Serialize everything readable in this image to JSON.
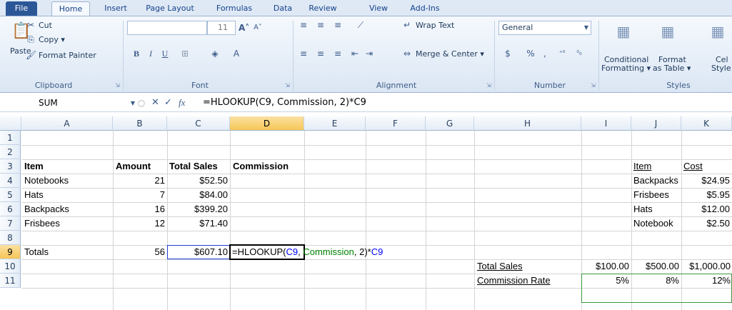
{
  "tabs": [
    "File",
    "Home",
    "Insert",
    "Page Layout",
    "Formulas",
    "Data",
    "Review",
    "View",
    "Add-Ins"
  ],
  "ribbon": {
    "clipboard": {
      "title": "Clipboard",
      "paste": "Paste",
      "cut": "Cut",
      "copy": "Copy ▾",
      "format_painter": "Format Painter"
    },
    "font": {
      "title": "Font",
      "size": "11",
      "bold": "B",
      "italic": "I",
      "underline": "U"
    },
    "alignment": {
      "title": "Alignment",
      "wrap_text": "Wrap Text",
      "merge_center": "Merge & Center ▾"
    },
    "number": {
      "title": "Number",
      "format": "General",
      "currency": "$",
      "percent": "%",
      "comma": ","
    },
    "styles": {
      "title": "Styles",
      "conditional": "Conditional",
      "conditional2": "Formatting ▾",
      "format_as": "Format",
      "format_as2": "as Table ▾",
      "cell_styles": "Cel",
      "cell_styles2": "Style"
    }
  },
  "formula_bar": {
    "name_box": "SUM",
    "formula": "=HLOOKUP(C9, Commission, 2)*C9",
    "cancel": "✕",
    "enter": "✓",
    "fx": "fx"
  },
  "columns": [
    "A",
    "B",
    "C",
    "D",
    "E",
    "F",
    "G",
    "H",
    "I",
    "J",
    "K"
  ],
  "rows": [
    "1",
    "2",
    "3",
    "4",
    "5",
    "6",
    "7",
    "8",
    "9",
    "10",
    "11"
  ],
  "cells": {
    "A3": "Item",
    "B3": "Amount",
    "C3": "Total Sales",
    "D3": "Commission",
    "A4": "Notebooks",
    "B4": "21",
    "C4": "$52.50",
    "A5": "Hats",
    "B5": "7",
    "C5": "$84.00",
    "A6": "Backpacks",
    "B6": "16",
    "C6": "$399.20",
    "A7": "Frisbees",
    "B7": "12",
    "C7": "$71.40",
    "A9": "Totals",
    "B9": "56",
    "C9": "$607.10",
    "D9_parts": [
      "=HLOOKUP(",
      "C9",
      ", ",
      "Commission",
      ", 2)*",
      "C9"
    ],
    "J3": "Item",
    "K3": "Cost",
    "J4": "Backpacks",
    "K4": "$24.95",
    "J5": "Frisbees",
    "K5": "$5.95",
    "J6": "Hats",
    "K6": "$12.00",
    "J7": "Notebook",
    "K7": "$2.50",
    "H10": "Total Sales",
    "I10": "$100.00",
    "J10": "$500.00",
    "K10": "$1,000.00",
    "H11": "Commission Rate",
    "I11": "5%",
    "J11": "8%",
    "K11": "12%"
  },
  "colors": {
    "ref_blue": "#0000ff",
    "ref_green": "#008000",
    "selection": "#f6c657"
  }
}
